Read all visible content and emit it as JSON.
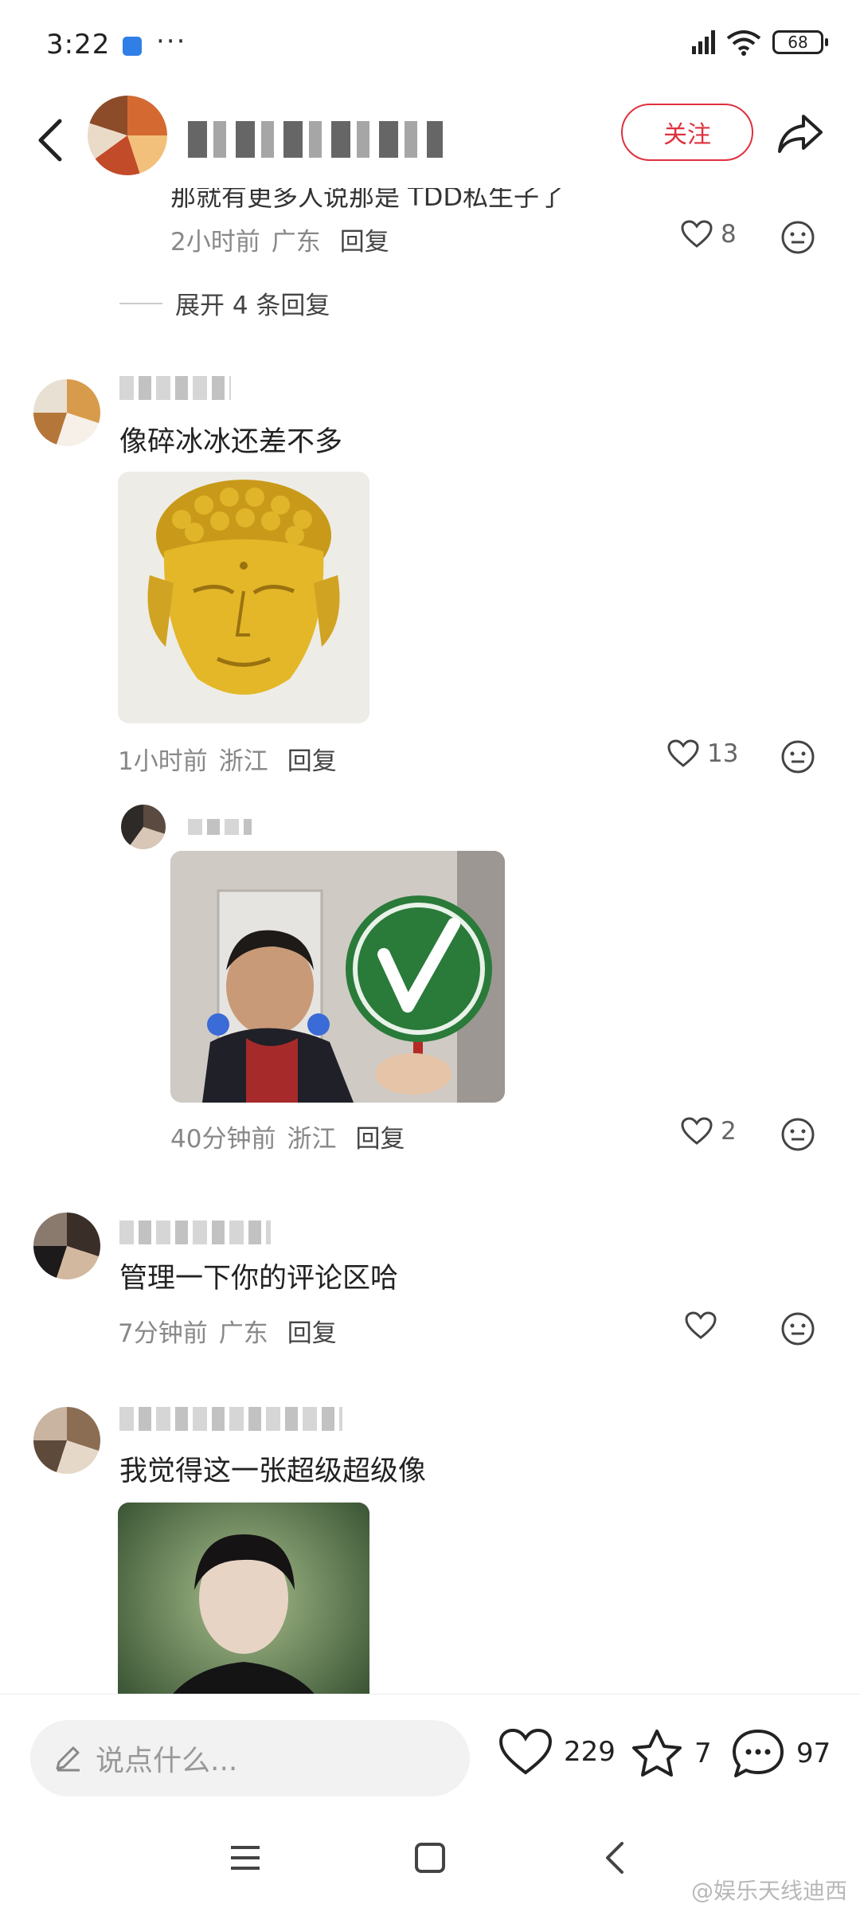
{
  "status_bar": {
    "time": "3:22",
    "more": "···",
    "battery": "68"
  },
  "header": {
    "follow_label": "关注"
  },
  "thread": {
    "prev_reply": {
      "text": "那就有更多人说那是 TDD私生子了",
      "time": "2小时前",
      "location": "广东",
      "reply_label": "回复",
      "likes": "8"
    },
    "expand_label": "展开 4 条回复"
  },
  "comments": [
    {
      "text": "像碎冰冰还差不多",
      "time": "1小时前",
      "location": "浙江",
      "reply_label": "回复",
      "likes": "13"
    },
    {
      "text": "",
      "time": "40分钟前",
      "location": "浙江",
      "reply_label": "回复",
      "likes": "2",
      "is_reply": true
    },
    {
      "text": "管理一下你的评论区哈",
      "time": "7分钟前",
      "location": "广东",
      "reply_label": "回复",
      "likes": ""
    },
    {
      "text": "我觉得这一张超级超级像"
    }
  ],
  "bottom_bar": {
    "input_placeholder": "说点什么...",
    "likes": "229",
    "favorites": "7",
    "comments": "97"
  },
  "watermark": "@娱乐天线迪西",
  "colors": {
    "accent": "#e0303e",
    "meta": "#888888",
    "input_bg": "#f2f2f2"
  },
  "icons": [
    "back-arrow-icon",
    "share-icon",
    "heart-icon",
    "emoji-icon",
    "pencil-icon",
    "star-icon",
    "chat-bubble-icon",
    "menu-icon",
    "home-square-icon",
    "nav-back-icon"
  ]
}
